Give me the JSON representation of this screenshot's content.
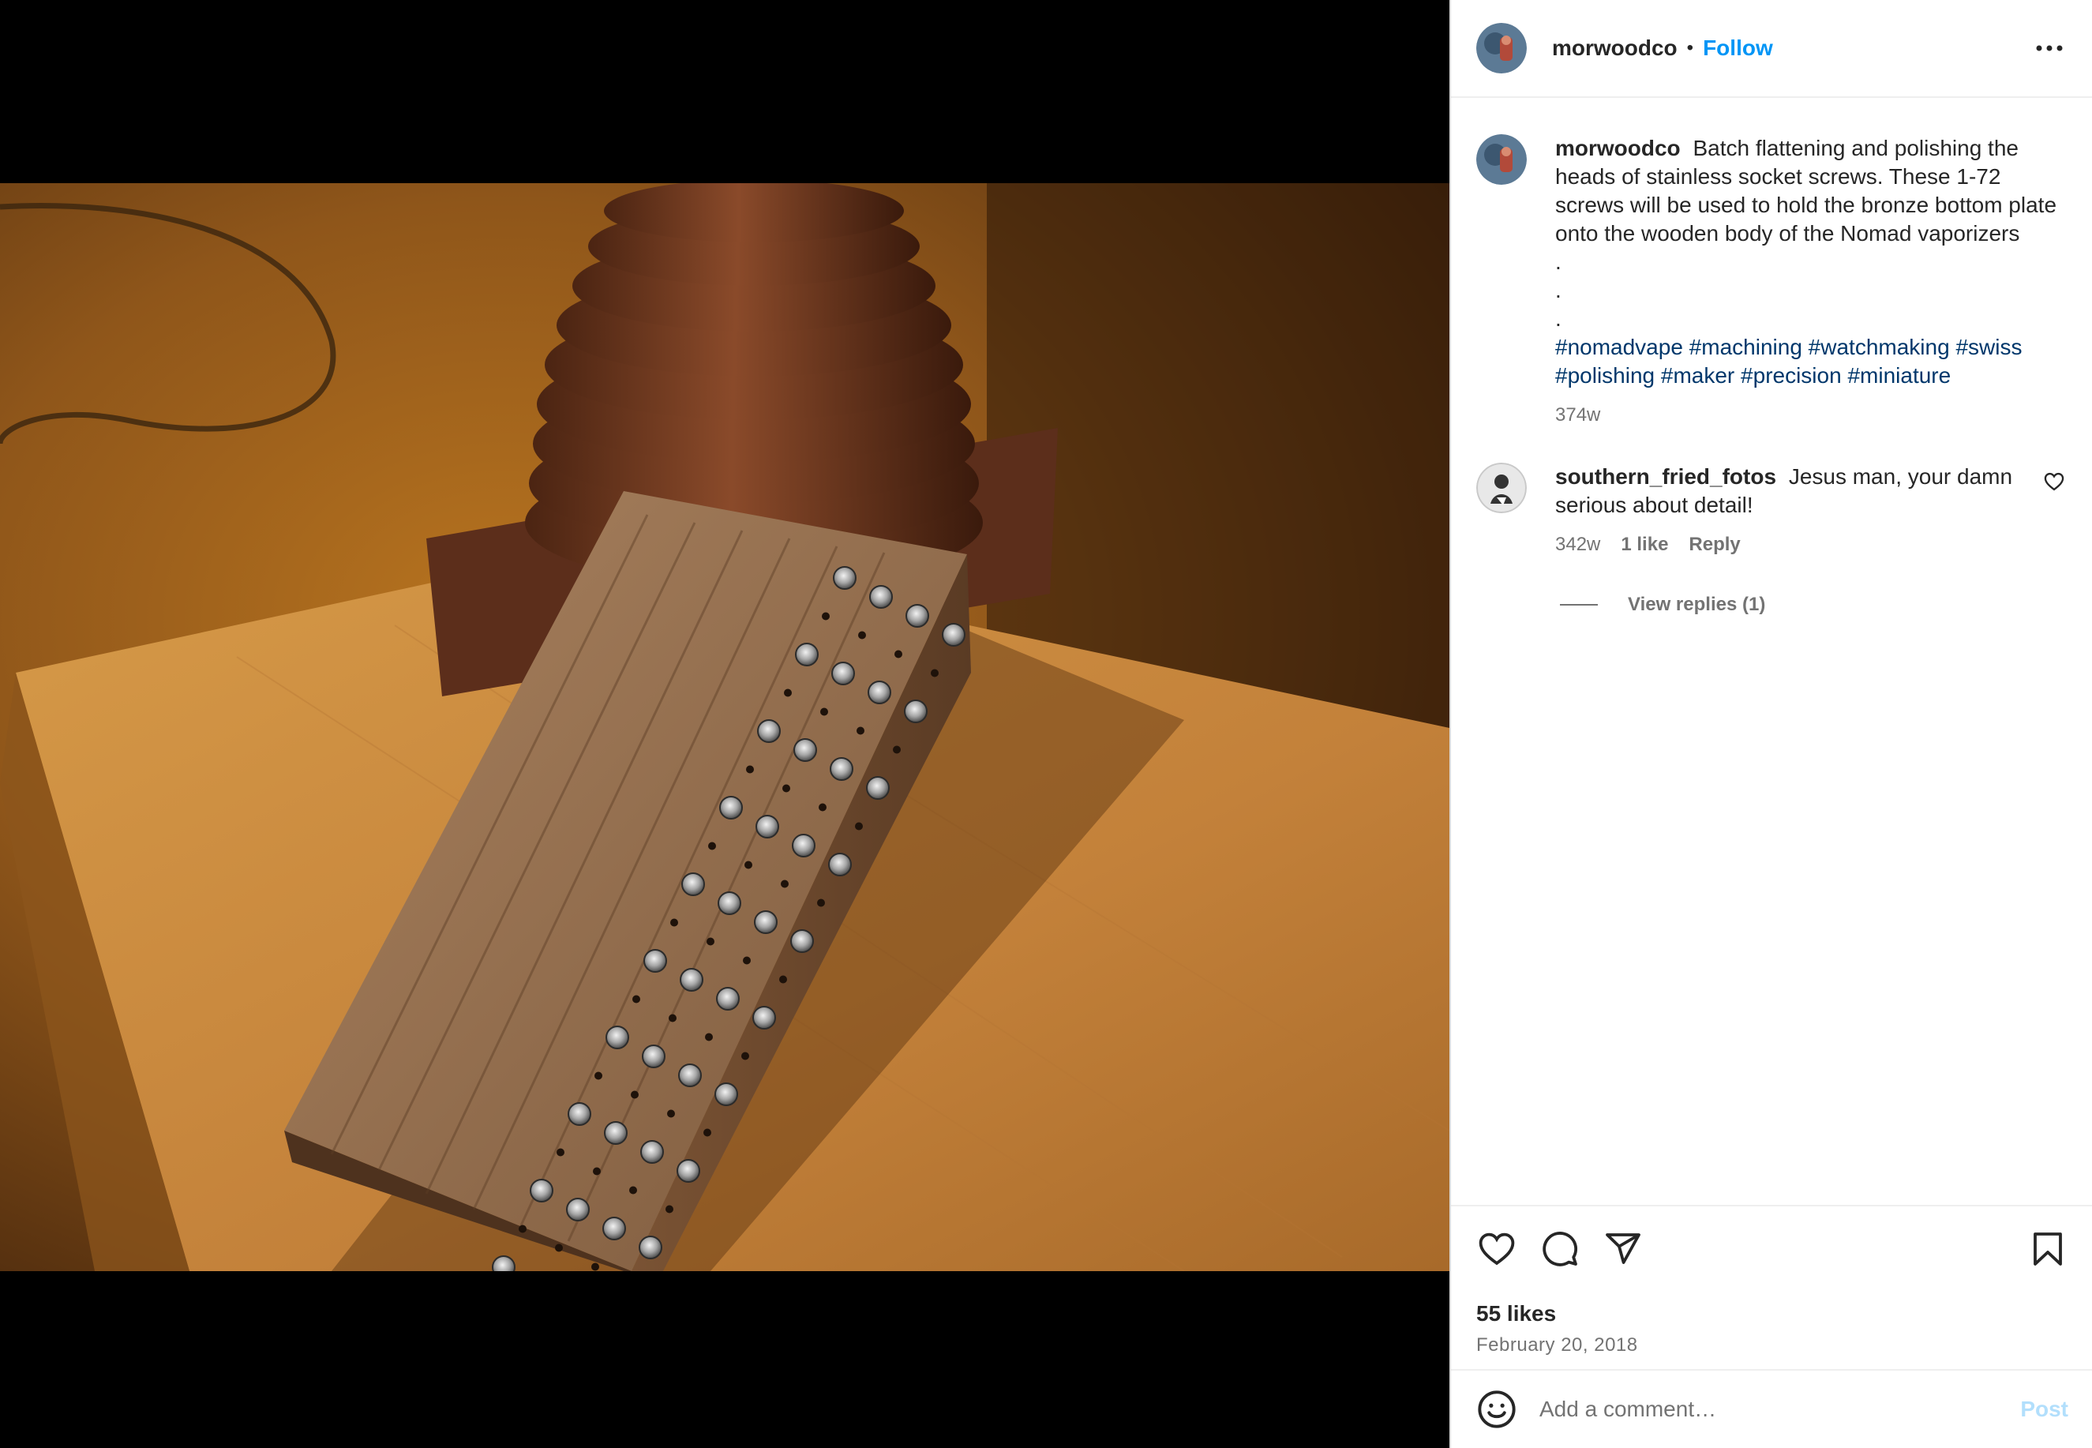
{
  "header": {
    "username": "morwoodco",
    "separator": "•",
    "follow_label": "Follow"
  },
  "caption": {
    "author": "morwoodco",
    "text": "Batch flattening and polishing the heads of stainless socket screws. These 1-72 screws will be used to hold the bronze bottom plate onto the wooden body of the Nomad vaporizers",
    "dots": [
      ".",
      ".",
      "."
    ],
    "hashtags": [
      "#nomadvape",
      "#machining",
      "#watchmaking",
      "#swiss",
      "#polishing",
      "#maker",
      "#precision",
      "#miniature"
    ],
    "age": "374w"
  },
  "comments": [
    {
      "author": "southern_fried_fotos",
      "text": "Jesus man, your damn serious about detail!",
      "age": "342w",
      "likes": "1 like",
      "reply_label": "Reply",
      "view_replies": "View replies (1)"
    }
  ],
  "actions": {
    "likes": "55 likes",
    "date": "February 20, 2018"
  },
  "add_comment": {
    "placeholder": "Add a comment…",
    "post_label": "Post"
  },
  "icons": {
    "more": "more-options-icon",
    "like": "heart-icon",
    "comment": "comment-bubble-icon",
    "share": "paper-plane-icon",
    "save": "bookmark-icon",
    "emoji": "emoji-smile-icon",
    "comment_like": "small-heart-icon"
  },
  "colors": {
    "link_blue": "#0095f6",
    "hashtag_blue": "#00376b",
    "muted": "#737373",
    "post_disabled": "#b2dffc"
  }
}
